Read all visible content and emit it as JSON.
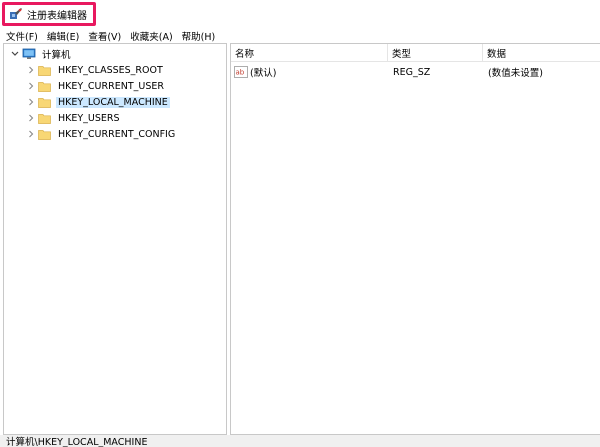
{
  "window": {
    "title": "注册表编辑器"
  },
  "menu": [
    {
      "label": "文件(F)"
    },
    {
      "label": "编辑(E)"
    },
    {
      "label": "查看(V)"
    },
    {
      "label": "收藏夹(A)"
    },
    {
      "label": "帮助(H)"
    }
  ],
  "tree": {
    "root": "计算机",
    "items": [
      {
        "label": "HKEY_CLASSES_ROOT",
        "selected": false
      },
      {
        "label": "HKEY_CURRENT_USER",
        "selected": false
      },
      {
        "label": "HKEY_LOCAL_MACHINE",
        "selected": true
      },
      {
        "label": "HKEY_USERS",
        "selected": false
      },
      {
        "label": "HKEY_CURRENT_CONFIG",
        "selected": false
      }
    ]
  },
  "list": {
    "columns": [
      "名称",
      "类型",
      "数据"
    ],
    "rows": [
      {
        "name": "(默认)",
        "type": "REG_SZ",
        "data": "(数值未设置)"
      }
    ]
  },
  "status": {
    "path": "计算机\\HKEY_LOCAL_MACHINE"
  },
  "colors": {
    "title_highlight": "#e8185f",
    "selection": "#cce8ff",
    "folder": "#f8d775"
  },
  "icons": {
    "app": "regedit-icon",
    "computer": "computer-icon",
    "folder": "folder-icon",
    "value": "string-value-icon"
  }
}
